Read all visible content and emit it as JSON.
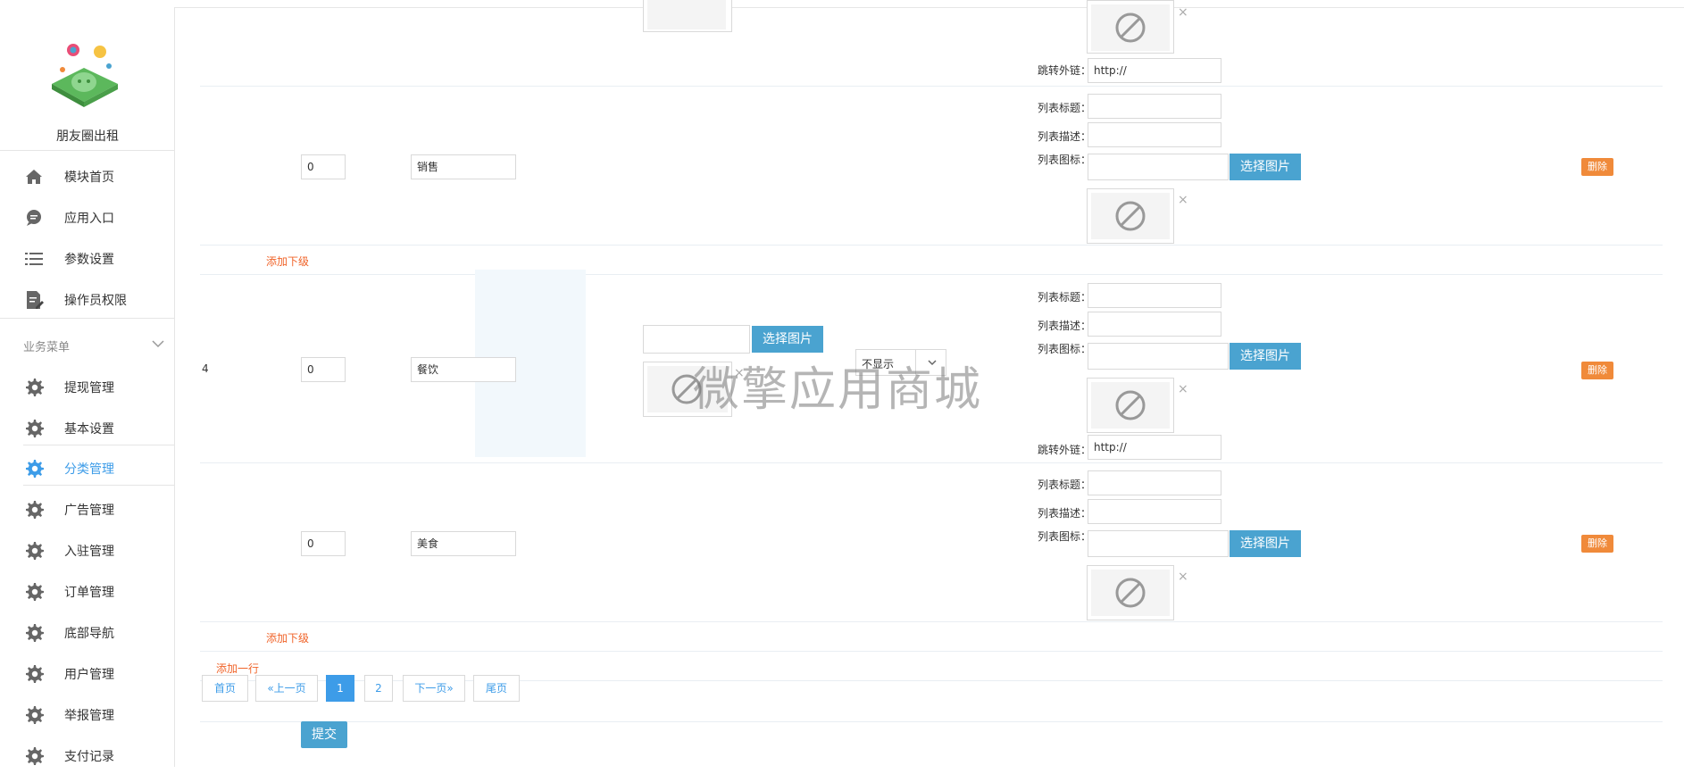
{
  "sidebar": {
    "app_name": "朋友圈出租",
    "menu": [
      {
        "label": "模块首页",
        "icon": "home-icon"
      },
      {
        "label": "应用入口",
        "icon": "chat-icon"
      },
      {
        "label": "参数设置",
        "icon": "list-icon"
      },
      {
        "label": "操作员权限",
        "icon": "edit-doc-icon"
      }
    ],
    "group_title": "业务菜单",
    "business_menu": [
      {
        "label": "提现管理",
        "icon": "gear-icon"
      },
      {
        "label": "基本设置",
        "icon": "gear-icon"
      },
      {
        "label": "分类管理",
        "icon": "gear-icon",
        "active": true
      },
      {
        "label": "广告管理",
        "icon": "gear-icon"
      },
      {
        "label": "入驻管理",
        "icon": "gear-icon"
      },
      {
        "label": "订单管理",
        "icon": "gear-icon"
      },
      {
        "label": "底部导航",
        "icon": "gear-icon"
      },
      {
        "label": "用户管理",
        "icon": "gear-icon"
      },
      {
        "label": "举报管理",
        "icon": "gear-icon"
      },
      {
        "label": "支付记录",
        "icon": "gear-icon"
      }
    ],
    "colors": {
      "active": "#3d9ce8"
    }
  },
  "form": {
    "label_title": "列表标题：",
    "label_desc": "列表描述：",
    "label_icon": "列表图标：",
    "label_link": "跳转外链：",
    "link_value": "http://",
    "pick_image": "选择图片",
    "placeholder_text": "暂无图片",
    "delete": "删除",
    "add_child": "添加下级",
    "add_row": "添加一行",
    "display_option": "不显示",
    "close_symbol": "×"
  },
  "rows": [
    {
      "id": "",
      "sort": "0",
      "name": "销售"
    },
    {
      "id": "4",
      "sort": "0",
      "name": "餐饮"
    },
    {
      "id": "",
      "sort": "0",
      "name": "美食"
    }
  ],
  "pagination": {
    "first": "首页",
    "prev": "«上一页",
    "pages": [
      "1",
      "2"
    ],
    "current": "1",
    "next": "下一页»",
    "last": "尾页"
  },
  "submit": "提交",
  "watermark": "微擎应用商城",
  "colors": {
    "primary_button": "#4aa3d0",
    "delete_button": "#f08a3a",
    "link_orange": "#f0642a",
    "page_active": "#3d9ce8"
  }
}
